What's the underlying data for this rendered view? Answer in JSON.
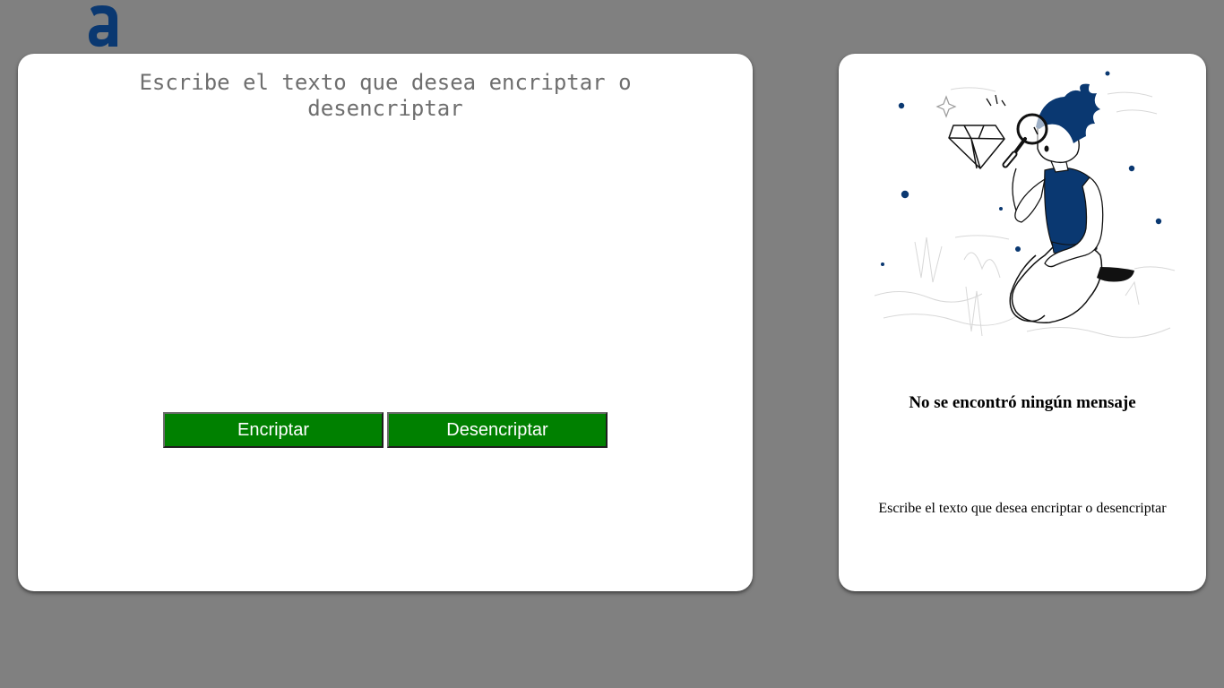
{
  "logo": {
    "icon": "alura-logo-icon",
    "color": "#0a3871"
  },
  "input": {
    "value": "",
    "placeholder": "Escribe el texto que desea encriptar o desencriptar"
  },
  "buttons": {
    "encrypt_label": "Encriptar",
    "decrypt_label": "Desencriptar",
    "color": "#008000"
  },
  "output": {
    "illustration": "person-with-magnifying-glass-illustration",
    "empty_title": "No se encontró ningún mensaje",
    "empty_subtitle": "Escribe el texto que desea encriptar o desencriptar"
  }
}
